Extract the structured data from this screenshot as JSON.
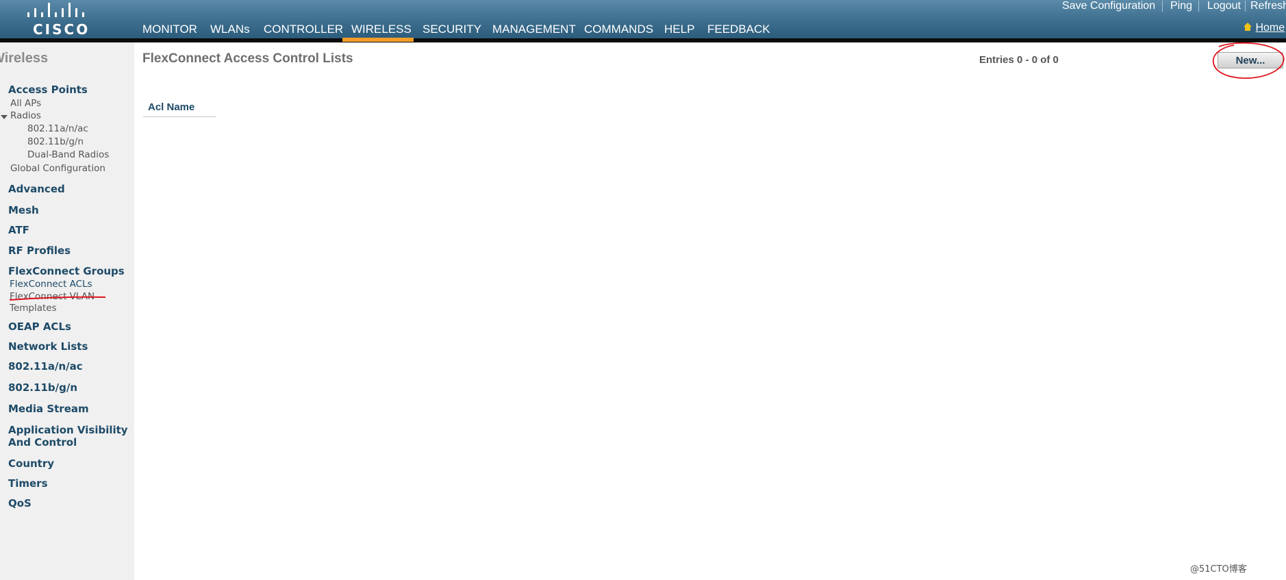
{
  "header": {
    "logo_text": "CISCO",
    "nav": [
      {
        "label": "MONITOR"
      },
      {
        "label": "WLANs"
      },
      {
        "label": "CONTROLLER"
      },
      {
        "label": "WIRELESS",
        "active": true
      },
      {
        "label": "SECURITY"
      },
      {
        "label": "MANAGEMENT"
      },
      {
        "label": "COMMANDS"
      },
      {
        "label": "HELP"
      },
      {
        "label": "FEEDBACK"
      }
    ],
    "utility_links": [
      "Save Configuration",
      "Ping",
      "Logout",
      "Refresh"
    ],
    "home_label": "Home",
    "active_tab_color": "#f29d28"
  },
  "sidebar": {
    "title": "Wireless",
    "access_points": "Access Points",
    "all_aps": "All APs",
    "radios": "Radios",
    "radio_11a": "802.11a/n/ac",
    "radio_11b": "802.11b/g/n",
    "radio_dual": "Dual-Band Radios",
    "global_config": "Global Configuration",
    "advanced": "Advanced",
    "mesh": "Mesh",
    "atf": "ATF",
    "rf_profiles": "RF Profiles",
    "flexconnect_groups": "FlexConnect Groups",
    "flexconnect_acls": "FlexConnect ACLs",
    "flexconnect_vlan_1": "FlexConnect VLAN",
    "flexconnect_vlan_2": "Templates",
    "oeap_acls": "OEAP ACLs",
    "network_lists": "Network Lists",
    "band_a": "802.11a/n/ac",
    "band_b": "802.11b/g/n",
    "media_stream": "Media Stream",
    "avc_1": "Application Visibility",
    "avc_2": "And Control",
    "country": "Country",
    "timers": "Timers",
    "qos": "QoS"
  },
  "main": {
    "title": "FlexConnect Access Control Lists",
    "entries": "Entries 0 - 0 of 0",
    "new_button": "New...",
    "table_header": "Acl Name"
  },
  "annotation": {
    "color": "#e0141e"
  },
  "watermark": "@51CTO博客"
}
